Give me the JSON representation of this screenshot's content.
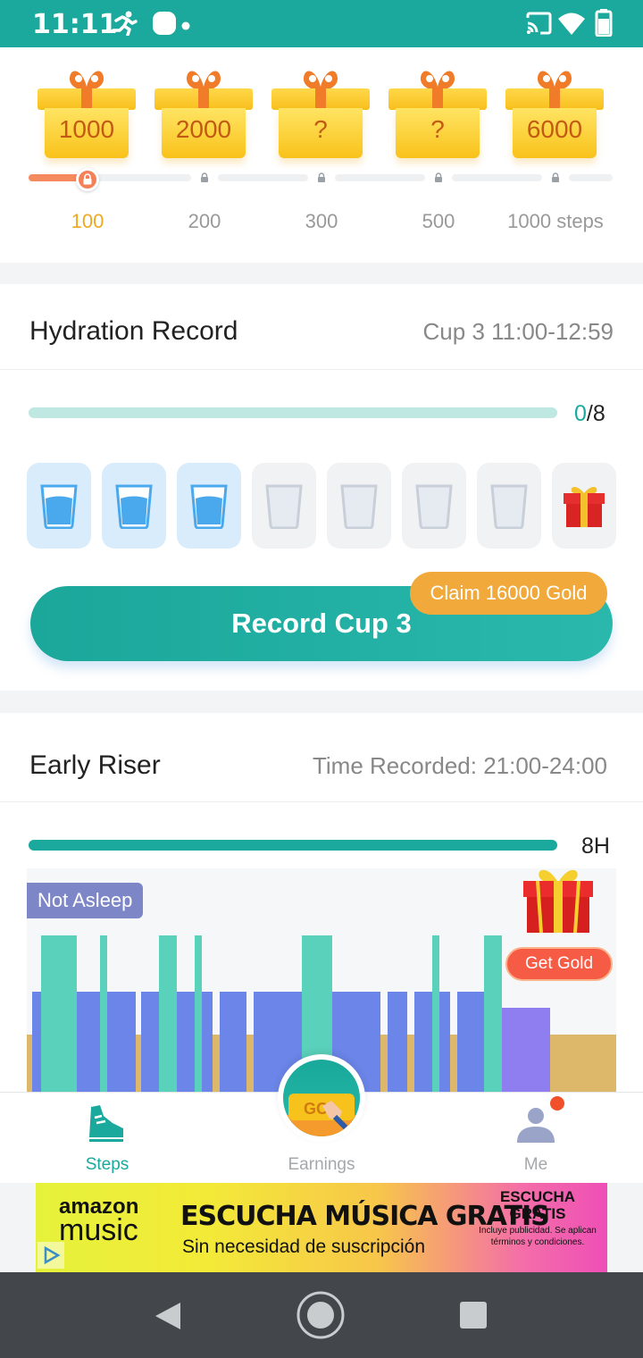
{
  "status_bar": {
    "time": "11:11",
    "icons": [
      "running-icon",
      "app-icon",
      "dot-icon",
      "cast-icon",
      "wifi-icon",
      "battery-icon"
    ]
  },
  "reward_track": {
    "gifts": [
      {
        "amount": "1000"
      },
      {
        "amount": "2000"
      },
      {
        "amount": "?"
      },
      {
        "amount": "?"
      },
      {
        "amount": "6000"
      }
    ],
    "milestones": [
      "100",
      "200",
      "300",
      "500",
      "1000 steps"
    ],
    "progress_fraction": 0.1
  },
  "hydration": {
    "title": "Hydration Record",
    "subtitle": "Cup 3 11:00-12:59",
    "count_done": "0",
    "count_total": "/8",
    "cups": [
      {
        "state": "filled"
      },
      {
        "state": "filled"
      },
      {
        "state": "filled"
      },
      {
        "state": "empty"
      },
      {
        "state": "empty"
      },
      {
        "state": "empty"
      },
      {
        "state": "empty"
      },
      {
        "state": "gift"
      }
    ],
    "button_label": "Record Cup 3",
    "claim_label": "Claim 16000 Gold"
  },
  "early_riser": {
    "title": "Early Riser",
    "subtitle": "Time Recorded: 21:00-24:00",
    "hours": "8H",
    "not_asleep_label": "Not Asleep",
    "get_gold_label": "Get Gold"
  },
  "bottom_nav": {
    "items": [
      {
        "label": "Steps",
        "icon": "shoe-icon",
        "active": true
      },
      {
        "label": "Earnings",
        "icon": "go-coin-icon",
        "active": false
      },
      {
        "label": "Me",
        "icon": "profile-icon",
        "active": false
      }
    ]
  },
  "ad": {
    "brand_top": "amazon",
    "brand_bottom": "music",
    "headline": "ESCUCHA MÚSICA GRATIS",
    "subline": "Sin necesidad de suscripción",
    "right_title_1": "ESCUCHA",
    "right_title_2": "GRATIS",
    "right_small": "Incluye publicidad. Se aplican términos y condiciones."
  },
  "colors": {
    "primary": "#1aa99c",
    "orange": "#f0a93a",
    "progress_orange": "#f58a5f",
    "milestone_active": "#eda922",
    "water": "#4aa8ec",
    "awake": "#5ad1bb",
    "light_sleep": "#6b85e8",
    "deep_sleep": "#8f7ef0",
    "rem": "#ddb76a"
  }
}
